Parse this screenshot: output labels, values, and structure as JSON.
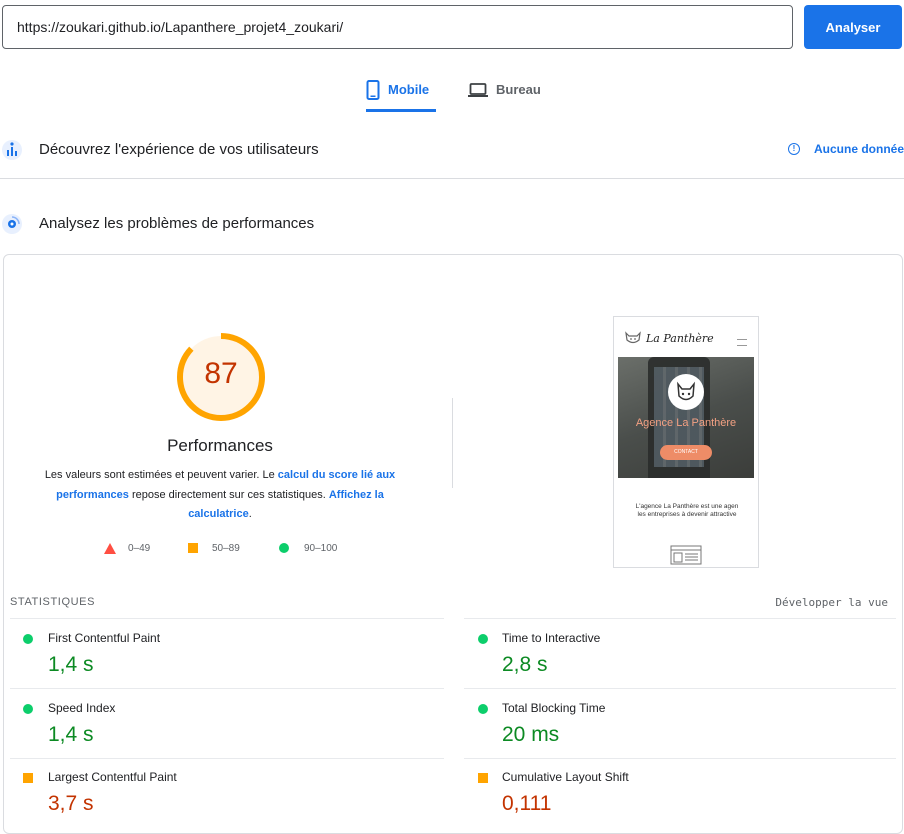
{
  "url_bar": {
    "value": "https://zoukari.github.io/Lapanthere_projet4_zoukari/",
    "button_label": "Analyser"
  },
  "tabs": [
    {
      "label": "Mobile",
      "icon": "smartphone-icon",
      "active": true
    },
    {
      "label": "Bureau",
      "icon": "laptop-icon",
      "active": false
    }
  ],
  "field_data": {
    "title": "Découvrez l'expérience de vos utilisateurs",
    "status": "Aucune donnée",
    "status_icon": "info-icon"
  },
  "lab_data": {
    "title": "Analysez les problèmes de performances"
  },
  "performance": {
    "score": 87,
    "score_color": "#c33300",
    "gauge_color": "#ffa400",
    "label": "Performances",
    "desc_part1": "Les valeurs sont estimées et peuvent varier. Le ",
    "desc_link1": "calcul du score lié aux performances",
    "desc_part2": " repose directement sur ces statistiques. ",
    "desc_link2": "Affichez la calculatrice",
    "desc_end": "."
  },
  "legend": [
    {
      "range": "0–49",
      "shape": "triangle",
      "color": "#ff4e42"
    },
    {
      "range": "50–89",
      "shape": "square",
      "color": "#ffa400"
    },
    {
      "range": "90–100",
      "shape": "circle",
      "color": "#0cce6b"
    }
  ],
  "screenshot": {
    "brand": "La Panthère",
    "hero_title": "Agence La Panthère",
    "cta": "CONTACT",
    "text_line1": "L'agence La Panthère est une agen",
    "text_line2": "les entreprises à devenir attractive"
  },
  "statistics": {
    "label": "STATISTIQUES",
    "expand_label": "Développer la vue",
    "metrics": [
      {
        "name": "First Contentful Paint",
        "value": "1,4 s",
        "rating": "good"
      },
      {
        "name": "Time to Interactive",
        "value": "2,8 s",
        "rating": "good"
      },
      {
        "name": "Speed Index",
        "value": "1,4 s",
        "rating": "good"
      },
      {
        "name": "Total Blocking Time",
        "value": "20 ms",
        "rating": "good"
      },
      {
        "name": "Largest Contentful Paint",
        "value": "3,7 s",
        "rating": "average"
      },
      {
        "name": "Cumulative Layout Shift",
        "value": "0,111",
        "rating": "average"
      }
    ]
  }
}
